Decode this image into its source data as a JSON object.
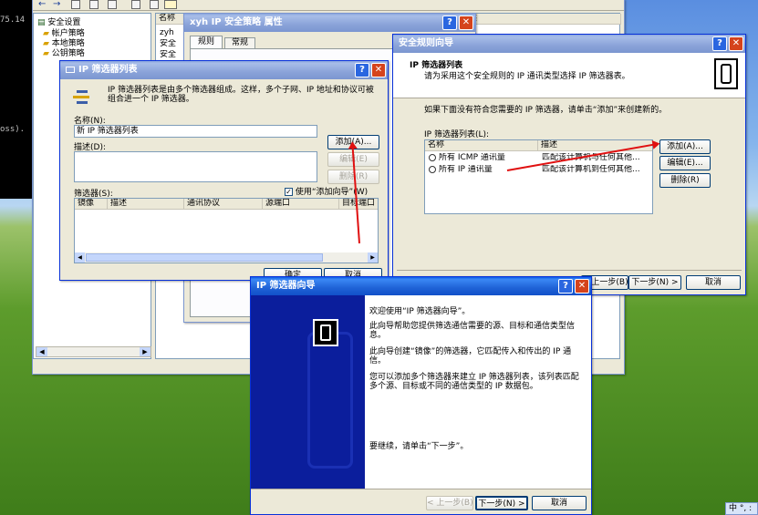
{
  "console": {
    "line1": "75.14",
    "line2": "oss)."
  },
  "mmc": {
    "toolbar_icons": [
      "back-icon",
      "forward-icon",
      "up-icon",
      "properties-icon",
      "refresh-icon",
      "export-icon",
      "help-icon"
    ],
    "tree": [
      "安全设置",
      "帐户策略",
      "本地策略",
      "公钥策略"
    ],
    "list_header": "名称",
    "list_items": [
      "zyh",
      "安全",
      "安全"
    ],
    "right_header": "述"
  },
  "props": {
    "title": "xyh IP 安全策略 属性",
    "tabs": [
      "规则",
      "常规"
    ]
  },
  "filter_list": {
    "title": "IP 筛选器列表",
    "desc": "IP 筛选器列表是由多个筛选器组成。这样，多个子网、IP 地址和协议可被组合进一个 IP 筛选器。",
    "name_label": "名称(N):",
    "name_value": "新 IP 筛选器列表",
    "desc_label": "描述(D):",
    "add": "添加(A)...",
    "edit": "编辑(E)",
    "remove": "删除(R)",
    "filters_label": "筛选器(S):",
    "use_wizard": "使用“添加向导”(W)",
    "columns": [
      "镜像",
      "描述",
      "通讯协议",
      "源端口",
      "目标端口"
    ],
    "ok": "确定",
    "cancel": "取消"
  },
  "rule_wizard": {
    "title": "安全规则向导",
    "heading": "IP 筛选器列表",
    "subheading": "请为采用这个安全规则的 IP 通讯类型选择 IP 筛选器表。",
    "instruction": "如果下面没有符合您需要的 IP 筛选器，请单击“添加”来创建新的。",
    "list_label": "IP 筛选器列表(L):",
    "columns": [
      "名称",
      "描述"
    ],
    "rows": [
      {
        "name": "所有 ICMP 通讯量",
        "desc": "匹配该计算机与任何其他..."
      },
      {
        "name": "所有 IP 通讯量",
        "desc": "匹配该计算机到任何其他..."
      }
    ],
    "add": "添加(A)...",
    "edit": "编辑(E)...",
    "remove": "删除(R)",
    "back": "< 上一步(B)",
    "next": "下一步(N) >",
    "cancel": "取消"
  },
  "filter_wizard": {
    "title": "IP 筛选器向导",
    "p1": "欢迎使用“IP 筛选器向导”。",
    "p2": "此向导帮助您提供筛选通信需要的源、目标和通信类型信息。",
    "p3": "此向导创建“镜像”的筛选器，它匹配传入和传出的 IP 通信。",
    "p4": "您可以添加多个筛选器来建立 IP 筛选器列表，该列表匹配多个源、目标或不同的通信类型的 IP 数据包。",
    "p5": "要继续，请单击“下一步”。",
    "back": "< 上一步(B)",
    "next": "下一步(N) >",
    "cancel": "取消"
  },
  "tray": {
    "text": "中 °, :"
  }
}
